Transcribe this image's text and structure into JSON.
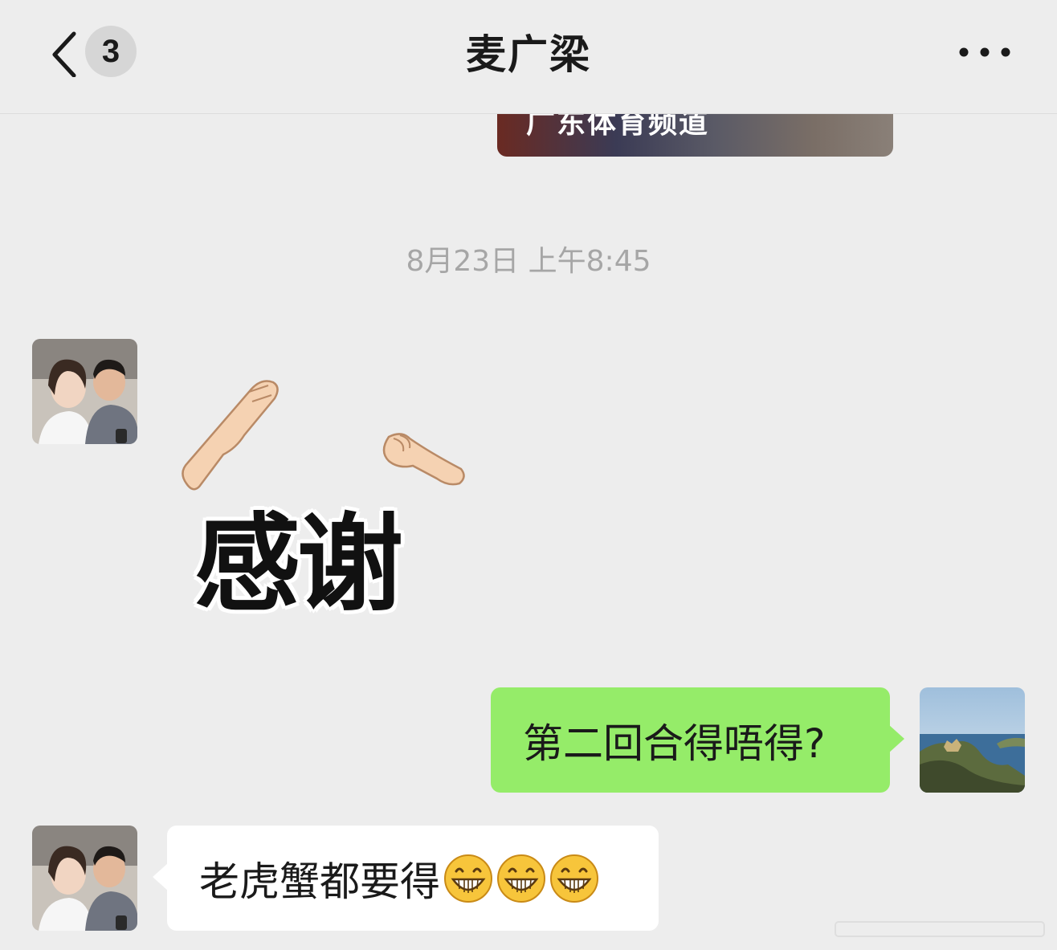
{
  "header": {
    "back_badge": "3",
    "title": "麦广梁"
  },
  "card_fragment": {
    "text": "广东体育频道"
  },
  "timestamp": "8月23日 上午8:45",
  "messages": [
    {
      "from": "contact",
      "type": "sticker",
      "text": "感谢"
    },
    {
      "from": "me",
      "type": "text",
      "text": "第二回合得唔得?"
    },
    {
      "from": "contact",
      "type": "text",
      "text": "老虎蟹都要得",
      "emoji_count": 3
    }
  ],
  "icons": {
    "back": "chevron-left-icon",
    "more": "more-dots-icon",
    "emoji": "grin-emoji"
  },
  "colors": {
    "background": "#ededed",
    "outgoing_bubble": "#95ec69",
    "incoming_bubble": "#ffffff",
    "timestamp": "#a6a6a6"
  }
}
